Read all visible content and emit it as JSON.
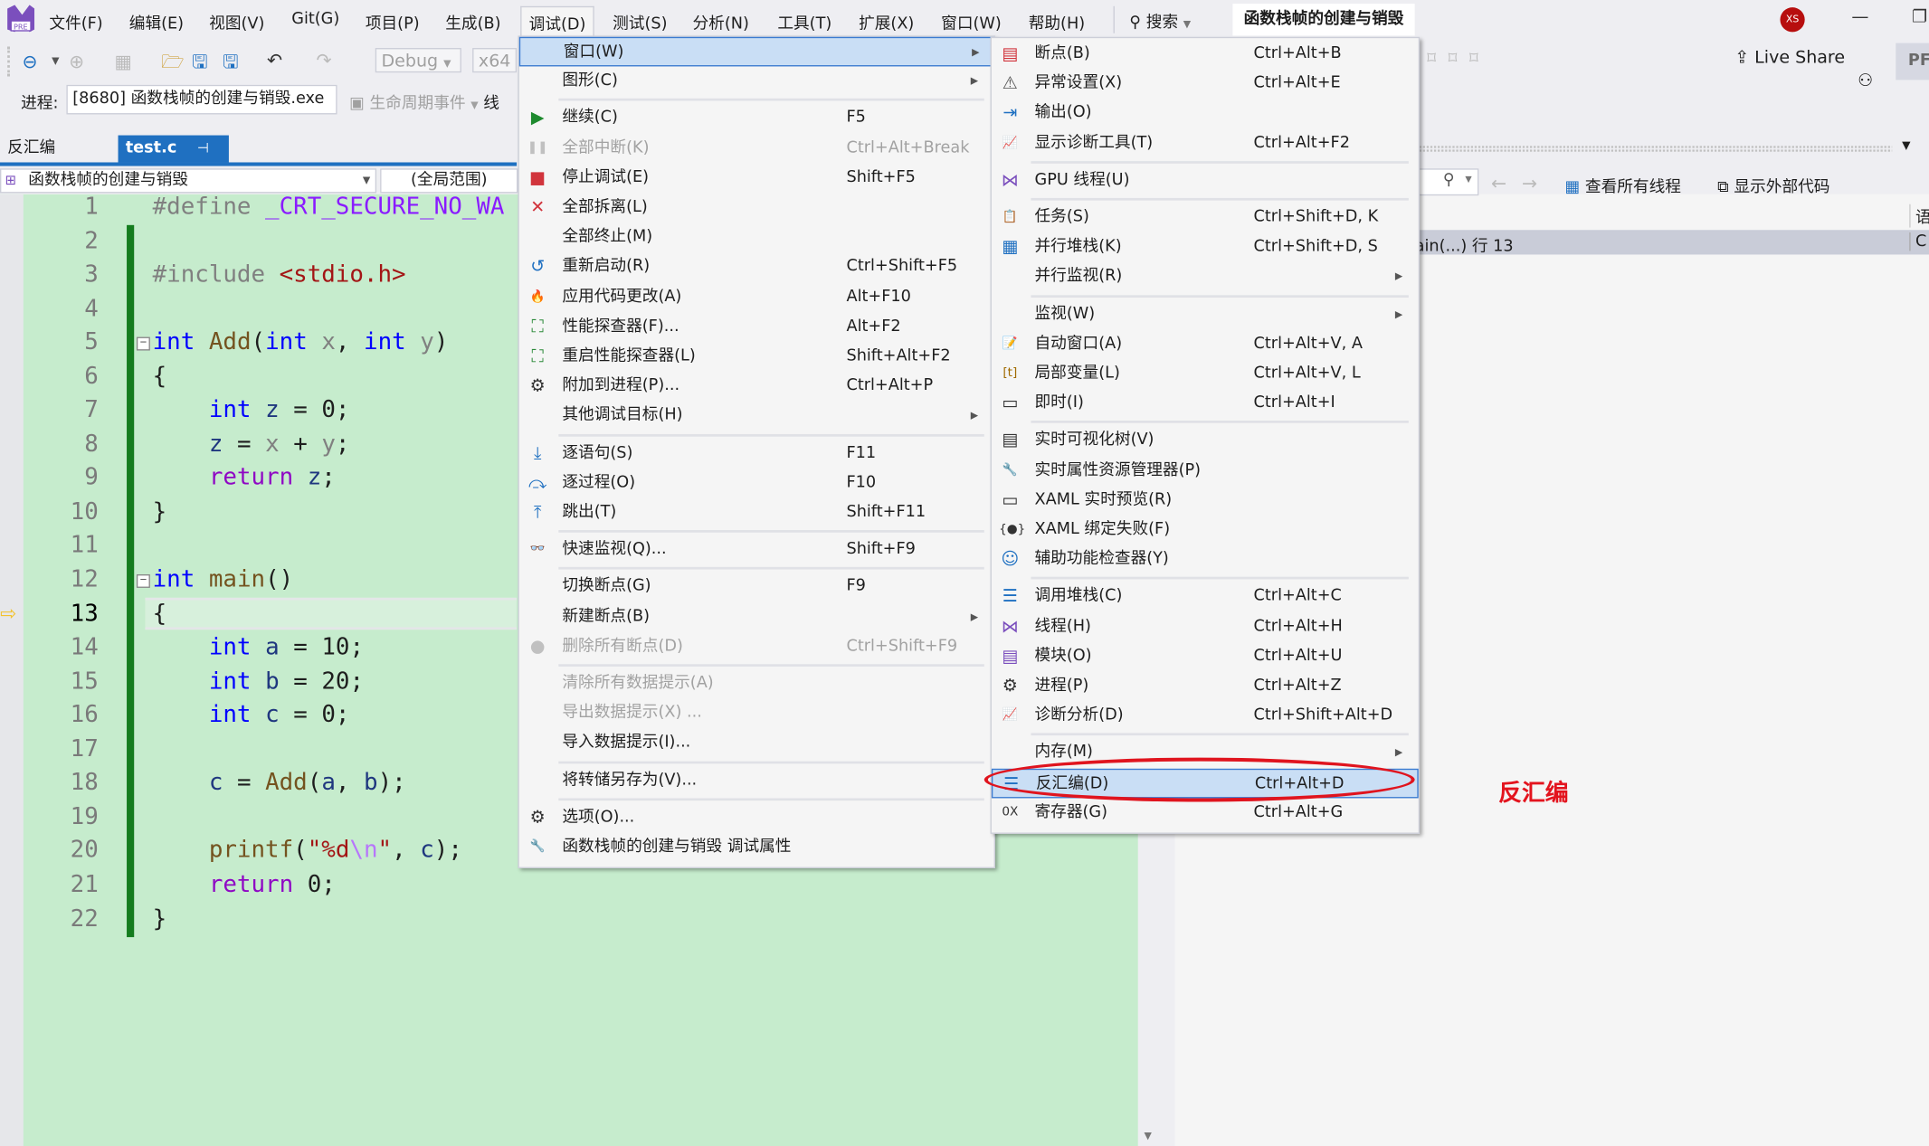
{
  "menubar": {
    "items": [
      "文件(F)",
      "编辑(E)",
      "视图(V)",
      "Git(G)",
      "项目(P)",
      "生成(B)",
      "调试(D)",
      "测试(S)",
      "分析(N)",
      "工具(T)",
      "扩展(X)",
      "窗口(W)",
      "帮助(H)"
    ],
    "active_index": 6,
    "search_label": "搜索",
    "solution_title": "函数栈帧的创建与销毁",
    "avatar_initials": "XS"
  },
  "toolbar": {
    "config": "Debug",
    "platform": "x64",
    "process_label": "进程:",
    "process_value": "[8680] 函数栈帧的创建与销毁.exe",
    "lifecycle_label": "生命周期事件",
    "thread_label": "线",
    "live_share": "Live Share",
    "preview_badge": "PF"
  },
  "tabs": [
    {
      "label": "反汇编",
      "active": false
    },
    {
      "label": "test.c",
      "active": true
    }
  ],
  "navbar": {
    "project": "函数栈帧的创建与销毁",
    "scope": "(全局范围)"
  },
  "editor": {
    "current_line": 13,
    "lines": [
      {
        "n": "1"
      },
      {
        "n": "2"
      },
      {
        "n": "3"
      },
      {
        "n": "4"
      },
      {
        "n": "5"
      },
      {
        "n": "6"
      },
      {
        "n": "7"
      },
      {
        "n": "8"
      },
      {
        "n": "9"
      },
      {
        "n": "10"
      },
      {
        "n": "11"
      },
      {
        "n": "12"
      },
      {
        "n": "13"
      },
      {
        "n": "14"
      },
      {
        "n": "15"
      },
      {
        "n": "16"
      },
      {
        "n": "17"
      },
      {
        "n": "18"
      },
      {
        "n": "19"
      },
      {
        "n": "20"
      },
      {
        "n": "21"
      },
      {
        "n": "22"
      }
    ],
    "code": {
      "l1_pp": "#define ",
      "l1_macro": "_CRT_SECURE_NO_WA",
      "l3_pp": "#include ",
      "l3_inc": "<stdio.h>",
      "int": "int",
      "add": "Add",
      "x": "x",
      "y": "y",
      "z": "z",
      "ret": "return",
      "main": "main",
      "a": "a",
      "b": "b",
      "c": "c",
      "v10": "10",
      "v20": "20",
      "v0": "0",
      "printf": "printf",
      "fmt1": "\"%d",
      "fmt_esc": "\\n",
      "fmt2": "\""
    }
  },
  "right_panel": {
    "view_all_threads": "查看所有线程",
    "show_external_code": "显示外部代码",
    "stack_row": "ain(...) 行 13",
    "lang_header": "语",
    "lang_value": "C"
  },
  "debug_menu": {
    "items": [
      {
        "label": "窗口(W)",
        "shortcut": "",
        "submenu": true,
        "icon": "",
        "highlighted": true
      },
      {
        "label": "图形(C)",
        "shortcut": "",
        "submenu": true,
        "icon": ""
      },
      {
        "label": "继续(C)",
        "shortcut": "F5",
        "icon": "play-icon"
      },
      {
        "label": "全部中断(K)",
        "shortcut": "Ctrl+Alt+Break",
        "icon": "pause-icon",
        "disabled": true
      },
      {
        "label": "停止调试(E)",
        "shortcut": "Shift+F5",
        "icon": "stop-icon"
      },
      {
        "label": "全部拆离(L)",
        "shortcut": "",
        "icon": "detach-icon"
      },
      {
        "label": "全部终止(M)",
        "shortcut": "",
        "icon": ""
      },
      {
        "label": "重新启动(R)",
        "shortcut": "Ctrl+Shift+F5",
        "icon": "restart-icon"
      },
      {
        "label": "应用代码更改(A)",
        "shortcut": "Alt+F10",
        "icon": "hot-reload-icon"
      },
      {
        "label": "性能探查器(F)...",
        "shortcut": "Alt+F2",
        "icon": "profiler-icon"
      },
      {
        "label": "重启性能探查器(L)",
        "shortcut": "Shift+Alt+F2",
        "icon": "profiler-restart-icon"
      },
      {
        "label": "附加到进程(P)...",
        "shortcut": "Ctrl+Alt+P",
        "icon": "attach-process-icon"
      },
      {
        "label": "其他调试目标(H)",
        "shortcut": "",
        "submenu": true,
        "icon": ""
      },
      {
        "label": "逐语句(S)",
        "shortcut": "F11",
        "icon": "step-into-icon"
      },
      {
        "label": "逐过程(O)",
        "shortcut": "F10",
        "icon": "step-over-icon"
      },
      {
        "label": "跳出(T)",
        "shortcut": "Shift+F11",
        "icon": "step-out-icon"
      },
      {
        "label": "快速监视(Q)...",
        "shortcut": "Shift+F9",
        "icon": "quickwatch-icon"
      },
      {
        "label": "切换断点(G)",
        "shortcut": "F9",
        "icon": ""
      },
      {
        "label": "新建断点(B)",
        "shortcut": "",
        "submenu": true,
        "icon": ""
      },
      {
        "label": "删除所有断点(D)",
        "shortcut": "Ctrl+Shift+F9",
        "icon": "delete-breakpoints-icon",
        "disabled": true
      },
      {
        "label": "清除所有数据提示(A)",
        "shortcut": "",
        "icon": "",
        "disabled": true
      },
      {
        "label": "导出数据提示(X) ...",
        "shortcut": "",
        "icon": "",
        "disabled": true
      },
      {
        "label": "导入数据提示(I)...",
        "shortcut": "",
        "icon": ""
      },
      {
        "label": "将转储另存为(V)...",
        "shortcut": "",
        "icon": ""
      },
      {
        "label": "选项(O)...",
        "shortcut": "",
        "icon": "gear-icon"
      },
      {
        "label": "函数栈帧的创建与销毁 调试属性",
        "shortcut": "",
        "icon": "wrench-icon"
      }
    ]
  },
  "windows_submenu": {
    "items": [
      {
        "label": "断点(B)",
        "shortcut": "Ctrl+Alt+B",
        "icon": "breakpoints-window-icon"
      },
      {
        "label": "异常设置(X)",
        "shortcut": "Ctrl+Alt+E",
        "icon": "exception-settings-icon"
      },
      {
        "label": "输出(O)",
        "shortcut": "",
        "icon": "output-icon"
      },
      {
        "label": "显示诊断工具(T)",
        "shortcut": "Ctrl+Alt+F2",
        "icon": "diagnostic-tools-icon"
      },
      {
        "label": "GPU 线程(U)",
        "shortcut": "",
        "icon": "gpu-threads-icon"
      },
      {
        "label": "任务(S)",
        "shortcut": "Ctrl+Shift+D, K",
        "icon": "tasks-icon"
      },
      {
        "label": "并行堆栈(K)",
        "shortcut": "Ctrl+Shift+D, S",
        "icon": "parallel-stacks-icon"
      },
      {
        "label": "并行监视(R)",
        "shortcut": "",
        "submenu": true,
        "icon": ""
      },
      {
        "label": "监视(W)",
        "shortcut": "",
        "submenu": true,
        "icon": ""
      },
      {
        "label": "自动窗口(A)",
        "shortcut": "Ctrl+Alt+V, A",
        "icon": "autos-icon"
      },
      {
        "label": "局部变量(L)",
        "shortcut": "Ctrl+Alt+V, L",
        "icon": "locals-icon"
      },
      {
        "label": "即时(I)",
        "shortcut": "Ctrl+Alt+I",
        "icon": "immediate-icon"
      },
      {
        "label": "实时可视化树(V)",
        "shortcut": "",
        "icon": "visual-tree-icon"
      },
      {
        "label": "实时属性资源管理器(P)",
        "shortcut": "",
        "icon": "property-explorer-icon"
      },
      {
        "label": "XAML 实时预览(R)",
        "shortcut": "",
        "icon": "xaml-preview-icon"
      },
      {
        "label": "XAML 绑定失败(F)",
        "shortcut": "",
        "icon": "xaml-binding-icon"
      },
      {
        "label": "辅助功能检查器(Y)",
        "shortcut": "",
        "icon": "accessibility-icon"
      },
      {
        "label": "调用堆栈(C)",
        "shortcut": "Ctrl+Alt+C",
        "icon": "call-stack-icon"
      },
      {
        "label": "线程(H)",
        "shortcut": "Ctrl+Alt+H",
        "icon": "threads-icon"
      },
      {
        "label": "模块(O)",
        "shortcut": "Ctrl+Alt+U",
        "icon": "modules-icon"
      },
      {
        "label": "进程(P)",
        "shortcut": "Ctrl+Alt+Z",
        "icon": "processes-icon"
      },
      {
        "label": "诊断分析(D)",
        "shortcut": "Ctrl+Shift+Alt+D",
        "icon": "diagnostic-analysis-icon"
      },
      {
        "label": "内存(M)",
        "shortcut": "",
        "submenu": true,
        "icon": ""
      },
      {
        "label": "反汇编(D)",
        "shortcut": "Ctrl+Alt+D",
        "icon": "disassembly-icon",
        "highlighted": true
      },
      {
        "label": "寄存器(G)",
        "shortcut": "Ctrl+Alt+G",
        "icon": "registers-icon"
      }
    ]
  },
  "annotation": {
    "text": "反汇编",
    "color": "#e3141e"
  },
  "colors": {
    "accent": "#1f70c1",
    "menu_highlight": "#c9def5",
    "editor_bg": "#c6eccd"
  }
}
